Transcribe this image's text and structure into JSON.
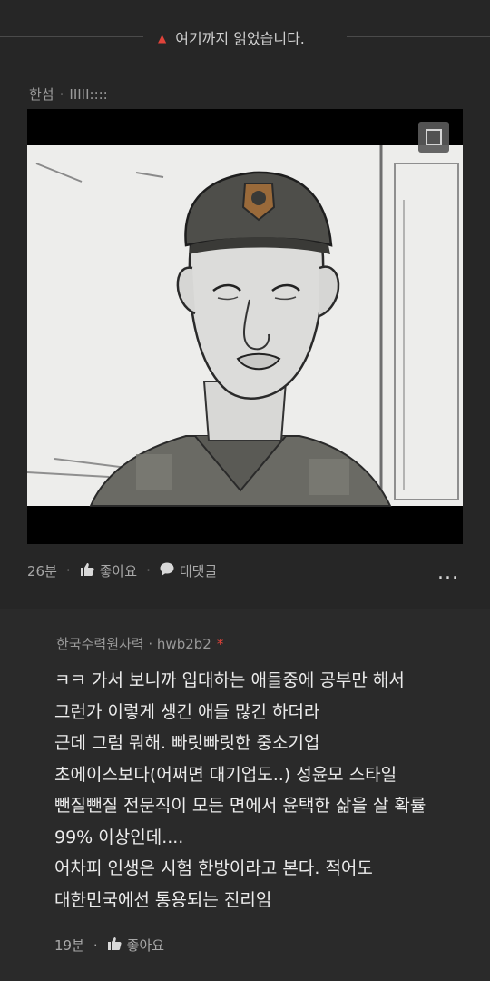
{
  "divider": {
    "label": "여기까지 읽었습니다."
  },
  "comment1": {
    "author": "한섬",
    "handle": "IIIII::::",
    "time": "26분",
    "like_label": "좋아요",
    "reply_label": "대댓글",
    "more_label": "..."
  },
  "comment2": {
    "author": "한국수력원자력",
    "handle": "hwb2b2",
    "badge": "*",
    "lines": [
      "ㅋㅋ 가서 보니까 입대하는 애들중에 공부만 해서",
      "그런가 이렇게 생긴 애들 많긴 하더라",
      "근데 그럼 뭐해. 빠릿빠릿한 중소기업",
      "초에이스보다(어쩌면 대기업도..) 성윤모 스타일",
      "뺀질뺀질 전문직이 모든 면에서 윤택한 삶을 살 확률",
      "99% 이상인데....",
      "어차피 인생은 시험 한방이라고 본다. 적어도",
      "대한민국에선 통용되는 진리임"
    ],
    "time": "19분",
    "like_label": "좋아요"
  },
  "icons": {
    "divider": "triangle-up-icon",
    "expand": "expand-icon",
    "like": "thumbs-up-icon",
    "reply": "speech-bubble-icon",
    "more": "more-icon"
  },
  "colors": {
    "accent": "#e0433a",
    "background": "#262626"
  }
}
